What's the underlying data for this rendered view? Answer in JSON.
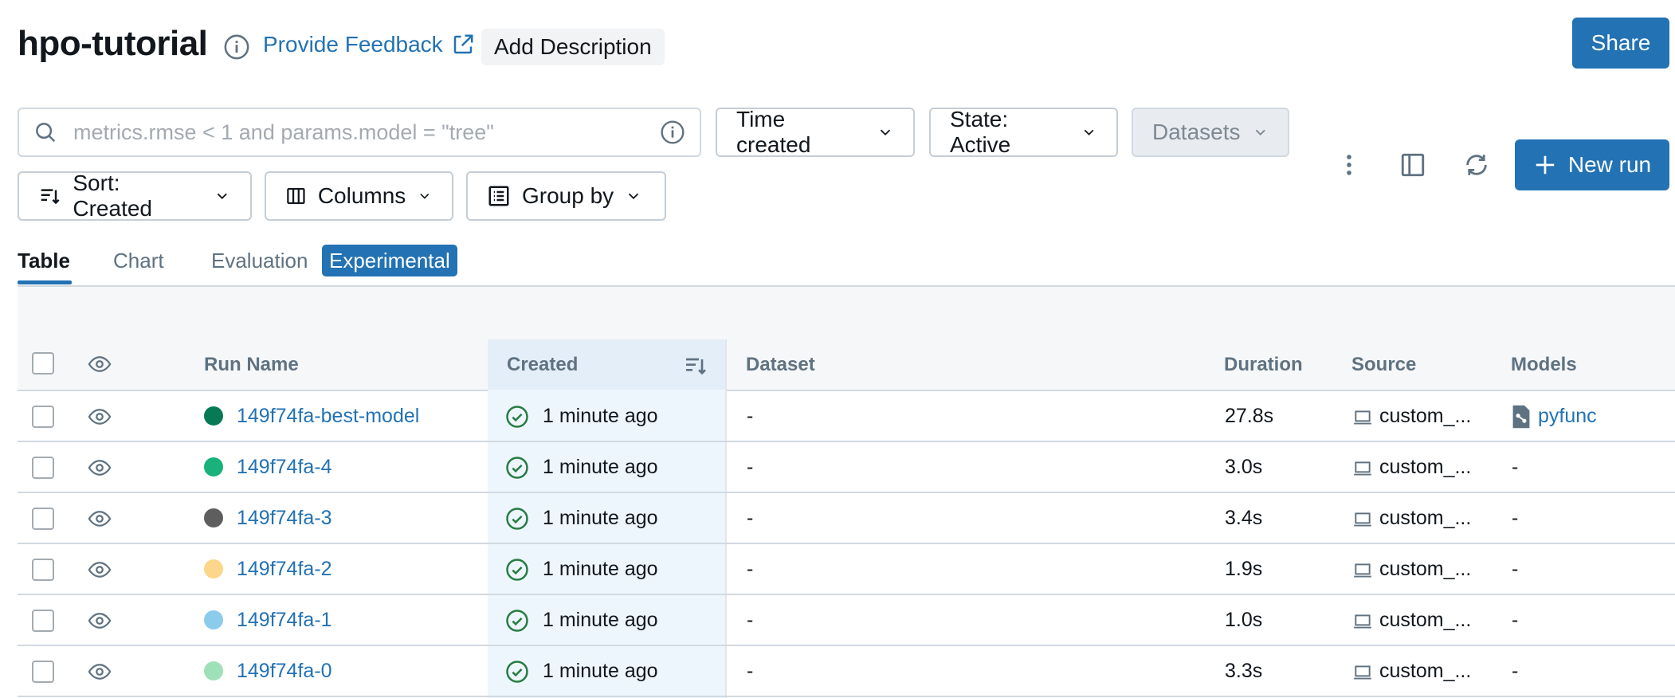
{
  "header": {
    "title": "hpo-tutorial",
    "feedback_label": "Provide Feedback",
    "add_description_label": "Add Description",
    "share_label": "Share"
  },
  "search": {
    "placeholder": "metrics.rmse < 1 and params.model = \"tree\""
  },
  "filters": {
    "time_created": "Time created",
    "state": "State: Active",
    "datasets": "Datasets",
    "sort": "Sort: Created",
    "columns": "Columns",
    "group_by": "Group by"
  },
  "actions": {
    "new_run": "New run"
  },
  "tabs": [
    {
      "label": "Table",
      "active": true
    },
    {
      "label": "Chart",
      "active": false
    },
    {
      "label": "Evaluation",
      "active": false
    }
  ],
  "experimental_badge": "Experimental",
  "table": {
    "columns": {
      "run_name": "Run Name",
      "created": "Created",
      "dataset": "Dataset",
      "duration": "Duration",
      "source": "Source",
      "models": "Models"
    },
    "rows": [
      {
        "color": "#077a55",
        "name": "149f74fa-best-model",
        "created": "1 minute ago",
        "dataset": "-",
        "duration": "27.8s",
        "source": "custom_...",
        "models": "pyfunc",
        "has_model": true
      },
      {
        "color": "#18b27a",
        "name": "149f74fa-4",
        "created": "1 minute ago",
        "dataset": "-",
        "duration": "3.0s",
        "source": "custom_...",
        "models": "-",
        "has_model": false
      },
      {
        "color": "#5e5e5e",
        "name": "149f74fa-3",
        "created": "1 minute ago",
        "dataset": "-",
        "duration": "3.4s",
        "source": "custom_...",
        "models": "-",
        "has_model": false
      },
      {
        "color": "#fcd68a",
        "name": "149f74fa-2",
        "created": "1 minute ago",
        "dataset": "-",
        "duration": "1.9s",
        "source": "custom_...",
        "models": "-",
        "has_model": false
      },
      {
        "color": "#8dcbed",
        "name": "149f74fa-1",
        "created": "1 minute ago",
        "dataset": "-",
        "duration": "1.0s",
        "source": "custom_...",
        "models": "-",
        "has_model": false
      },
      {
        "color": "#9ee0b8",
        "name": "149f74fa-0",
        "created": "1 minute ago",
        "dataset": "-",
        "duration": "3.3s",
        "source": "custom_...",
        "models": "-",
        "has_model": false
      }
    ]
  },
  "colors": {
    "accent": "#2272b4",
    "success": "#277c43"
  }
}
